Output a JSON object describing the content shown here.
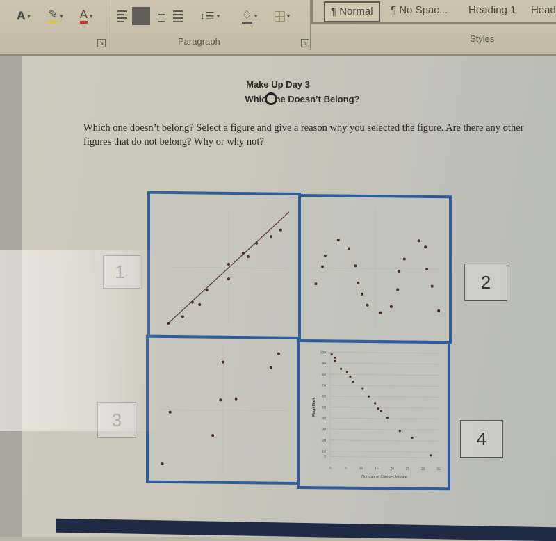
{
  "ribbon": {
    "font_group": {
      "text_effects_icon": "A",
      "highlight_icon": "✎",
      "font_color_icon": "A",
      "highlight_color": "#d9c34a",
      "font_color": "#c0392b"
    },
    "paragraph_group": {
      "label": "Paragraph"
    },
    "styles_group": {
      "label": "Styles",
      "items": [
        {
          "label": "¶ Normal",
          "selected": true
        },
        {
          "label": "¶ No Spac...",
          "selected": false
        },
        {
          "label": "Heading 1",
          "selected": false
        },
        {
          "label": "Headi",
          "selected": false
        }
      ]
    }
  },
  "document": {
    "title_line1": "Make Up Day 3",
    "title_line2_a": "Whic",
    "title_line2_b": "ne Doesn’t Belong?",
    "prompt": "Which one doesn’t belong?  Select a figure and give a reason why you selected the figure.  Are there any other figures that do not belong?  Why or why not?",
    "labels": [
      "1",
      "2",
      "3",
      "4"
    ],
    "label_1_mark": "·"
  },
  "chart_data": [
    {
      "id": 1,
      "type": "scatter",
      "title": "",
      "xlabel": "",
      "ylabel": "",
      "trendline": {
        "from": [
          0,
          0
        ],
        "to": [
          10,
          10
        ]
      },
      "x": [
        0,
        1.2,
        2.0,
        2.6,
        3.2,
        5.0,
        5.0,
        6.2,
        6.6,
        7.3,
        8.5,
        9.3
      ],
      "y": [
        0,
        0.6,
        1.9,
        1.7,
        3.0,
        4.0,
        5.3,
        6.3,
        6.0,
        7.2,
        7.8,
        8.4
      ],
      "xlim": [
        0,
        10
      ],
      "ylim": [
        0,
        10
      ]
    },
    {
      "id": 2,
      "type": "scatter",
      "title": "",
      "xlabel": "",
      "ylabel": "",
      "x": [
        0.5,
        1.0,
        1.2,
        2.2,
        3.0,
        3.5,
        3.7,
        4.0,
        4.4,
        5.4,
        6.2,
        6.7,
        6.8,
        7.2,
        8.3,
        8.8,
        8.9,
        9.3,
        9.8
      ],
      "y": [
        3.7,
        5.1,
        6.0,
        7.3,
        6.6,
        5.2,
        3.8,
        2.9,
        2.0,
        1.4,
        1.9,
        3.3,
        4.8,
        5.8,
        7.3,
        6.8,
        5.0,
        3.6,
        1.6
      ],
      "xlim": [
        0,
        10
      ],
      "ylim": [
        0,
        10
      ]
    },
    {
      "id": 3,
      "type": "scatter",
      "title": "",
      "xlabel": "",
      "ylabel": "",
      "x": [
        0.3,
        0.9,
        4.2,
        4.8,
        5.0,
        6.0,
        8.7,
        9.3
      ],
      "y": [
        0.7,
        4.8,
        3.0,
        5.8,
        8.8,
        5.9,
        8.4,
        9.5
      ],
      "xlim": [
        0,
        10
      ],
      "ylim": [
        0,
        10
      ]
    },
    {
      "id": 4,
      "type": "scatter",
      "title": "",
      "xlabel": "Number of Classes Missed",
      "ylabel": "Final Mark",
      "x": [
        0.5,
        1.5,
        1.5,
        3.5,
        5.5,
        6.5,
        7.5,
        10.5,
        12.5,
        14.5,
        15.5,
        16.5,
        18.5,
        22.5,
        26.5,
        32.5
      ],
      "y": [
        98,
        95,
        92,
        85,
        82,
        78,
        73,
        67,
        60,
        54,
        49,
        47,
        41,
        29,
        23,
        7
      ],
      "xticks": [
        "0",
        "5",
        "10",
        "15",
        "20",
        "25",
        "30",
        "35"
      ],
      "yticks": [
        "5",
        "10",
        "20",
        "30",
        "40",
        "50",
        "60",
        "70",
        "80",
        "90",
        "100"
      ],
      "xlim": [
        0,
        35
      ],
      "ylim": [
        0,
        100
      ],
      "grid": true
    }
  ]
}
